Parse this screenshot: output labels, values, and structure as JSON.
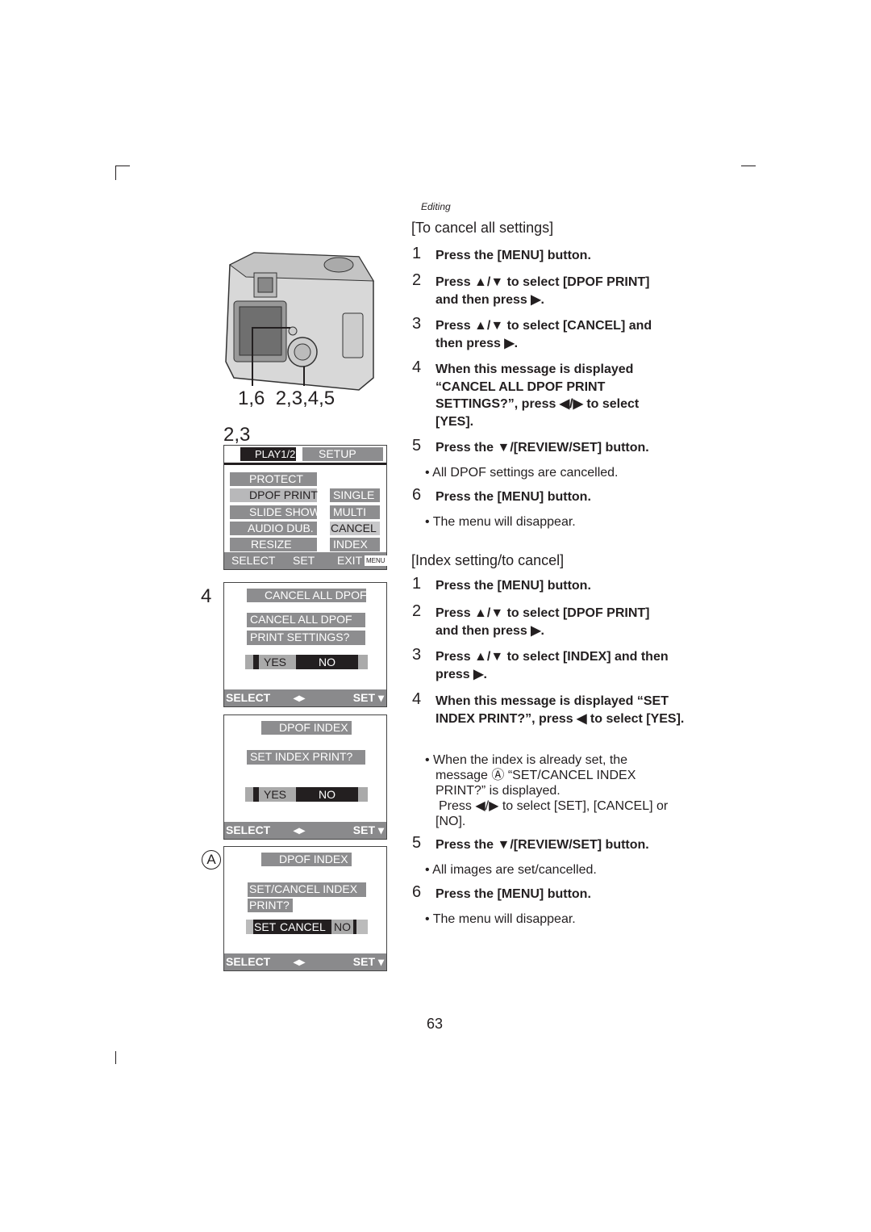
{
  "section": "Editing",
  "figure_labels": {
    "camera_callouts": "1,6  2,3,4,5",
    "screen1_label": "2,3",
    "screen2_label": "4",
    "screen4_label": "A"
  },
  "screen_menu": {
    "tab_play": "PLAY1/2",
    "tab_setup": "SETUP",
    "items": [
      "PROTECT",
      "DPOF PRINT",
      "SLIDE SHOW",
      "AUDIO DUB.",
      "RESIZE"
    ],
    "options": [
      "SINGLE",
      "MULTI",
      "CANCEL",
      "INDEX"
    ],
    "footer_select": "SELECT",
    "footer_set": "SET",
    "footer_exit": "EXIT",
    "menu_badge": "MENU"
  },
  "screen_cancel": {
    "title": "CANCEL ALL DPOF",
    "line1": "CANCEL ALL DPOF",
    "line2": "PRINT SETTINGS?",
    "yes": "YES",
    "no": "NO",
    "footer_select": "SELECT",
    "footer_set": "SET"
  },
  "screen_index": {
    "title": "DPOF INDEX",
    "line1": "SET INDEX PRINT?",
    "yes": "YES",
    "no": "NO",
    "footer_select": "SELECT",
    "footer_set": "SET"
  },
  "screen_setcancel": {
    "title": "DPOF INDEX",
    "line1": "SET/CANCEL INDEX",
    "line2": "PRINT?",
    "set": "SET",
    "cancel": "CANCEL",
    "no": "NO",
    "footer_select": "SELECT",
    "footer_set": "SET"
  },
  "cancel_all": {
    "heading": "[To cancel all settings]",
    "steps": [
      {
        "n": "1",
        "text": "Press the [MENU] button."
      },
      {
        "n": "2",
        "text": "Press ▲/▼ to select [DPOF PRINT] and then press ▶."
      },
      {
        "n": "3",
        "text": "Press ▲/▼ to select [CANCEL] and then press ▶."
      },
      {
        "n": "4",
        "text": "When this message is displayed “CANCEL ALL DPOF PRINT SETTINGS?”, press ◀/▶ to select [YES]."
      },
      {
        "n": "5",
        "text": "Press the ▼/[REVIEW/SET] button.",
        "note": "• All DPOF settings are cancelled."
      },
      {
        "n": "6",
        "text": "Press the [MENU] button.",
        "note": "• The menu will disappear."
      }
    ]
  },
  "index": {
    "heading": "[Index setting/to cancel]",
    "steps": [
      {
        "n": "1",
        "text": "Press the [MENU] button."
      },
      {
        "n": "2",
        "text": "Press ▲/▼ to select [DPOF PRINT] and then press ▶."
      },
      {
        "n": "3",
        "text": "Press ▲/▼ to select [INDEX] and then press ▶."
      },
      {
        "n": "4",
        "text": "When this message is displayed “SET INDEX PRINT?”, press ◀ to select [YES].",
        "note": "• When the index is already set, the message Ⓐ “SET/CANCEL INDEX PRINT?” is displayed.",
        "note2": "Press ◀/▶ to select [SET], [CANCEL] or [NO]."
      },
      {
        "n": "5",
        "text": "Press the ▼/[REVIEW/SET] button.",
        "note": "• All images are set/cancelled."
      },
      {
        "n": "6",
        "text": "Press the [MENU] button.",
        "note": "• The menu will disappear."
      }
    ]
  },
  "page_number": "63"
}
